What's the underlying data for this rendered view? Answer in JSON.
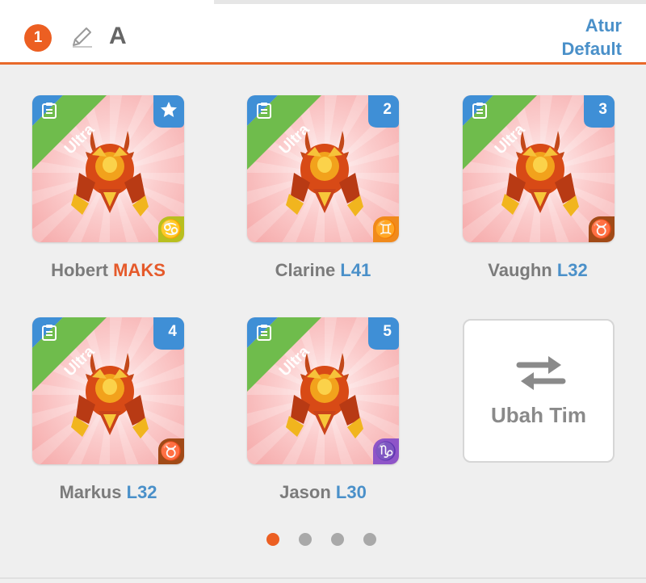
{
  "header": {
    "team_number": "1",
    "font_label": "A",
    "default_label_line1": "Atur",
    "default_label_line2": "Default",
    "accent_color": "#e8692a",
    "link_color": "#4a90c9"
  },
  "team": [
    {
      "name": "Hobert",
      "level": "MAKS",
      "rarity": "Ultra",
      "slot": "star",
      "zodiac": "cancer",
      "zodiac_glyph": "♋",
      "zodiac_color": "#b8bf1f"
    },
    {
      "name": "Clarine",
      "level": "L41",
      "rarity": "Ultra",
      "slot": "2",
      "zodiac": "gemini",
      "zodiac_glyph": "♊",
      "zodiac_color": "#f08a1c"
    },
    {
      "name": "Vaughn",
      "level": "L32",
      "rarity": "Ultra",
      "slot": "3",
      "zodiac": "taurus",
      "zodiac_glyph": "♉",
      "zodiac_color": "#a14a17"
    },
    {
      "name": "Markus",
      "level": "L32",
      "rarity": "Ultra",
      "slot": "4",
      "zodiac": "taurus",
      "zodiac_glyph": "♉",
      "zodiac_color": "#a14a17"
    },
    {
      "name": "Jason",
      "level": "L30",
      "rarity": "Ultra",
      "slot": "5",
      "zodiac": "capricorn",
      "zodiac_glyph": "♑",
      "zodiac_color": "#8e55c8"
    }
  ],
  "swap_team": {
    "label": "Ubah Tim",
    "icon": "swap-arrows-icon"
  },
  "pagination": {
    "total": 4,
    "active": 1
  }
}
